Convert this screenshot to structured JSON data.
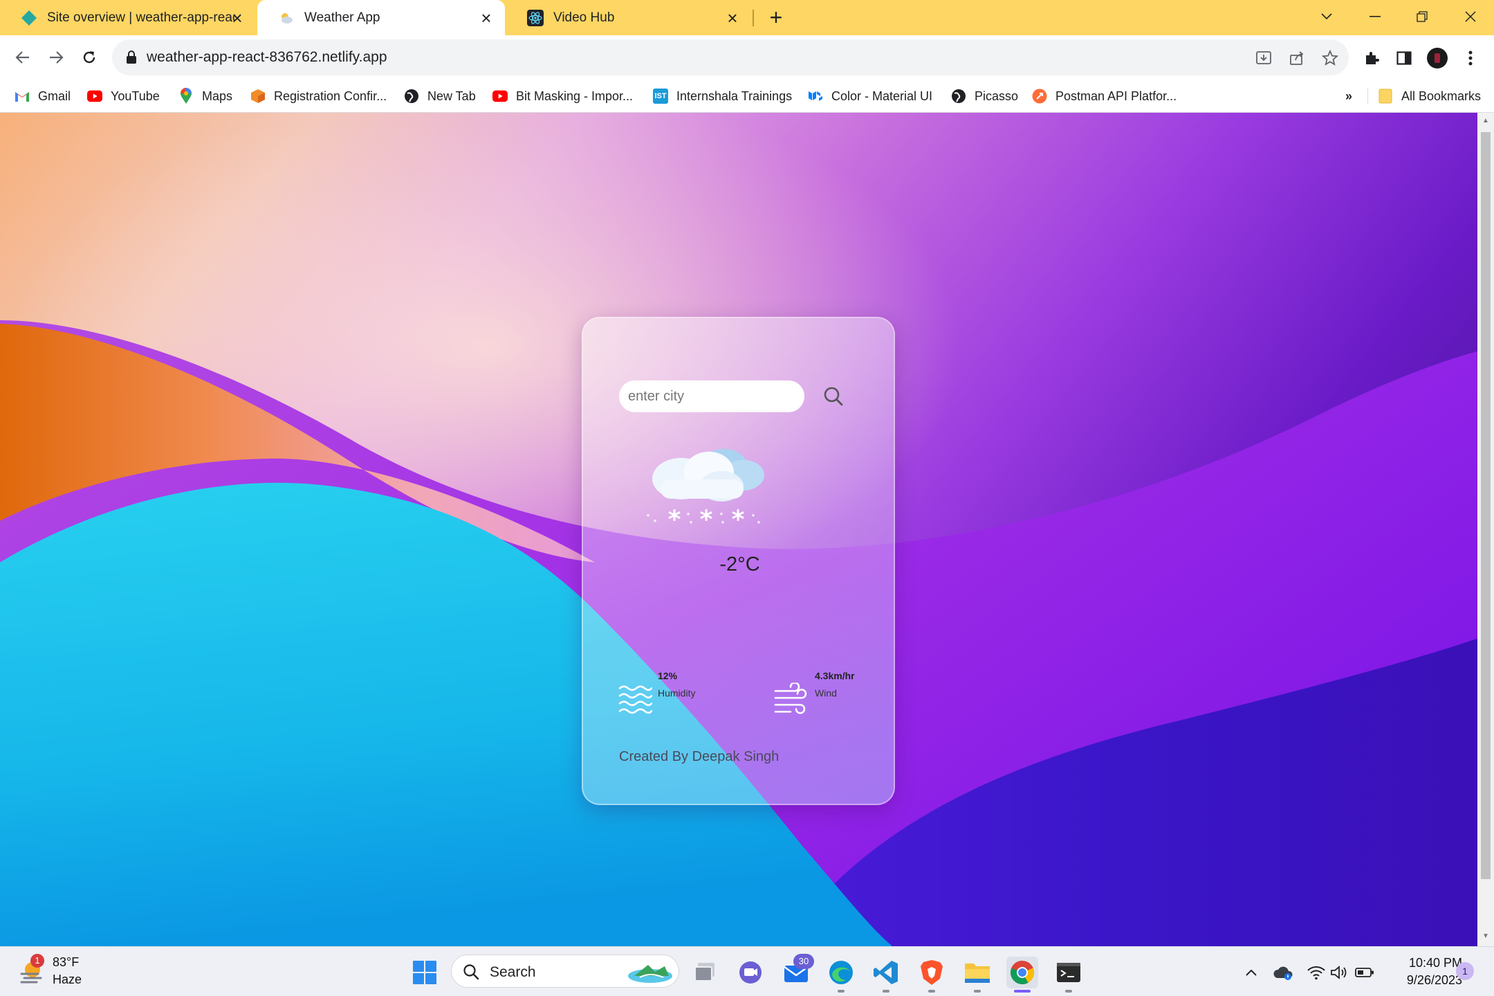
{
  "browser": {
    "tabs": [
      {
        "title": "Site overview | weather-app-reac",
        "active": false
      },
      {
        "title": "Weather App",
        "active": true
      },
      {
        "title": "Video Hub",
        "active": false
      }
    ],
    "url": "weather-app-react-836762.netlify.app",
    "bookmarks": [
      {
        "label": "Gmail",
        "icon": "gmail-icon"
      },
      {
        "label": "YouTube",
        "icon": "youtube-icon"
      },
      {
        "label": "Maps",
        "icon": "maps-icon"
      },
      {
        "label": "Registration Confir...",
        "icon": "box-icon"
      },
      {
        "label": "New Tab",
        "icon": "globe-icon"
      },
      {
        "label": "Bit Masking - Impor...",
        "icon": "youtube-icon"
      },
      {
        "label": "Internshala Trainings",
        "icon": "ist-icon"
      },
      {
        "label": "Color - Material UI",
        "icon": "mui-icon"
      },
      {
        "label": "Picasso",
        "icon": "globe-icon"
      },
      {
        "label": "Postman API Platfor...",
        "icon": "postman-icon"
      }
    ],
    "bookmarks_overflow": "»",
    "all_bookmarks": "All Bookmarks",
    "ist_text": "IST"
  },
  "app": {
    "search_placeholder": "enter city",
    "temperature": "-2°C",
    "condition_icon": "snow-cloud-icon",
    "humidity_value": "12%",
    "humidity_label": "Humidity",
    "wind_value": "4.3km/hr",
    "wind_label": "Wind",
    "credit": "Created By Deepak Singh"
  },
  "taskbar": {
    "weather_badge": "1",
    "weather_temp": "83°F",
    "weather_condition": "Haze",
    "search_label": "Search",
    "mail_badge": "30",
    "time": "10:40 PM",
    "date": "9/26/2023",
    "notification_count": "1"
  },
  "colors": {
    "tab_strip": "#FDD663",
    "accent": "#7a5cff"
  }
}
